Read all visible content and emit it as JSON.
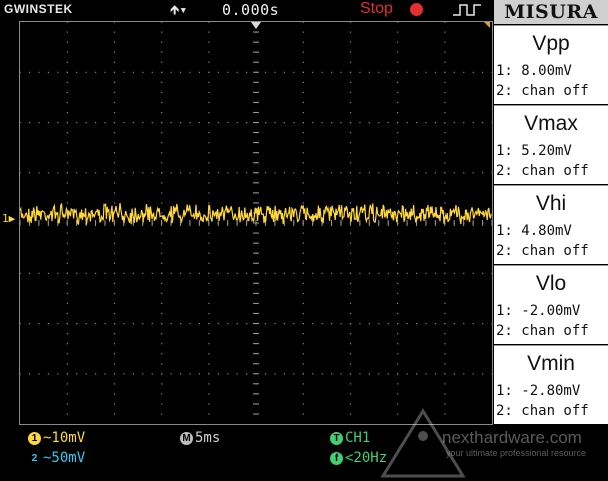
{
  "header": {
    "brand": "GWINSTEK",
    "trigger_delay": "0.000s",
    "run_status": "Stop",
    "trigger_icon": "rising-edge-icon"
  },
  "display": {
    "channel_marker": "1"
  },
  "measure_panel": {
    "title": "MISURA",
    "items": [
      {
        "name": "Vpp",
        "ch1": "1: 8.00mV",
        "ch2": "2: chan off"
      },
      {
        "name": "Vmax",
        "ch1": "1: 5.20mV",
        "ch2": "2: chan off"
      },
      {
        "name": "Vhi",
        "ch1": "1: 4.80mV",
        "ch2": "2: chan off"
      },
      {
        "name": "Vlo",
        "ch1": "1: -2.00mV",
        "ch2": "2: chan off"
      },
      {
        "name": "Vmin",
        "ch1": "1: -2.80mV",
        "ch2": "2: chan off"
      }
    ]
  },
  "bottom_bar": {
    "ch1_badge": "1",
    "ch1_scale": "~10mV",
    "ch2_badge": "2",
    "ch2_scale": "~50mV",
    "time_badge": "M",
    "timebase": "5ms",
    "trigger_badge": "T",
    "trigger_source": "CH1",
    "freq_badge": "f",
    "frequency": "<20Hz"
  },
  "watermark": {
    "text": "nexthardware.com",
    "subtitle": "your ultimate professional resource"
  },
  "colors": {
    "ch1": "#ffd83a",
    "ch2": "#38c8f0",
    "trigger": "#40d070",
    "stop": "#e23030"
  }
}
